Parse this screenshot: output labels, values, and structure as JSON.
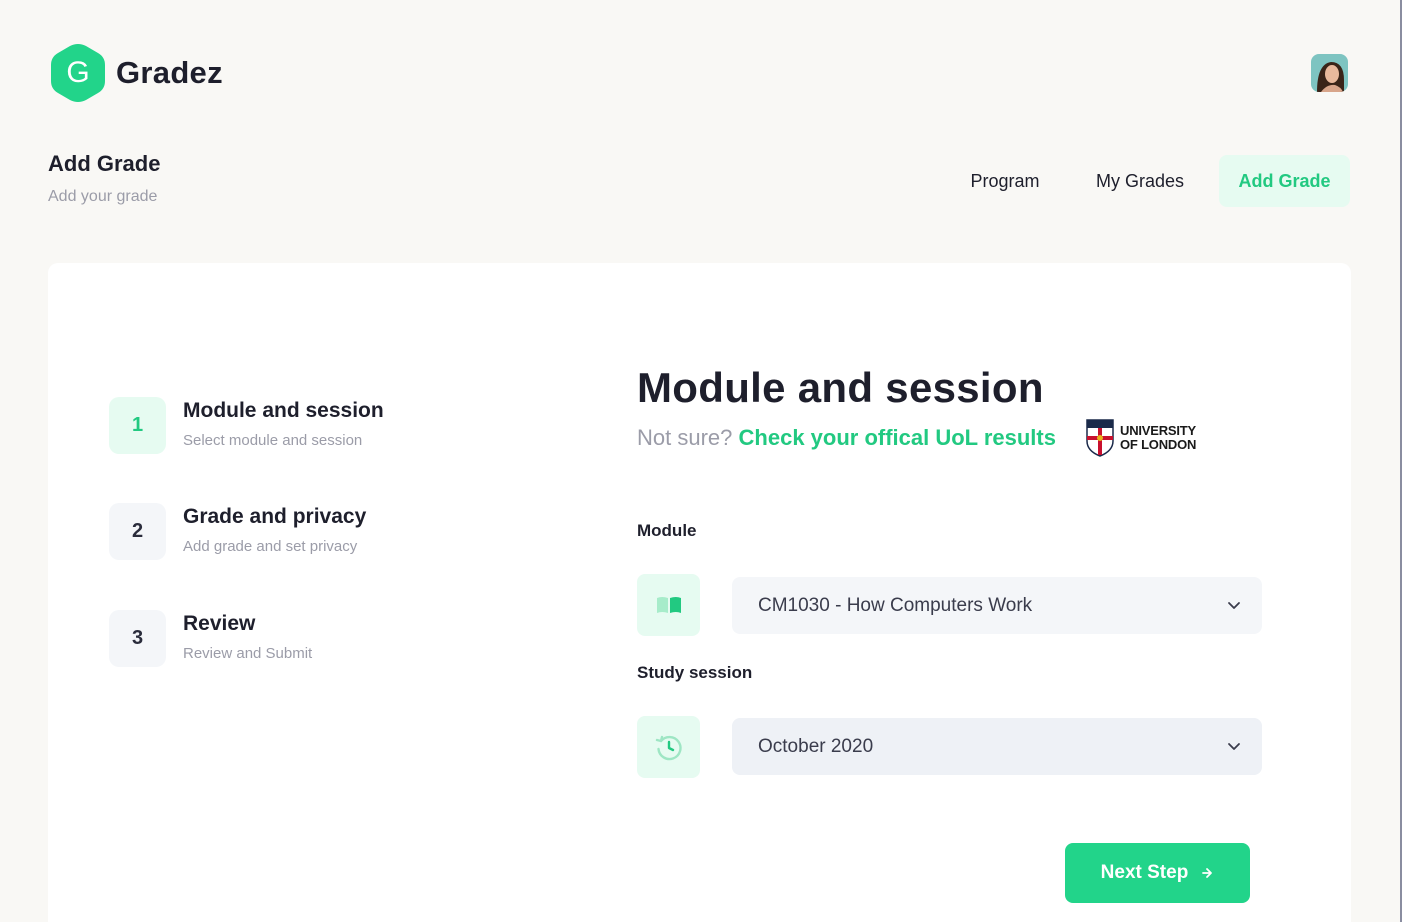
{
  "brand": {
    "letter": "G",
    "name": "Gradez",
    "accent": "#22c981"
  },
  "header": {
    "title": "Add Grade",
    "subtitle": "Add your grade",
    "avatar_icon": "user-avatar"
  },
  "nav": {
    "items": [
      {
        "label": "Program",
        "active": false
      },
      {
        "label": "My Grades",
        "active": false
      },
      {
        "label": "Add Grade",
        "active": true
      }
    ]
  },
  "steps": [
    {
      "number": "1",
      "title": "Module and session",
      "subtitle": "Select module and session",
      "active": true
    },
    {
      "number": "2",
      "title": "Grade and privacy",
      "subtitle": "Add grade and set privacy",
      "active": false
    },
    {
      "number": "3",
      "title": "Review",
      "subtitle": "Review and Submit",
      "active": false
    }
  ],
  "main": {
    "title": "Module and session",
    "not_sure": "Not sure?",
    "uol_link": "Check your offical UoL results",
    "uol_logo_line1": "UNIVERSITY",
    "uol_logo_line2": "OF LONDON"
  },
  "form": {
    "module_label": "Module",
    "module_value": "CM1030 - How Computers Work",
    "module_icon": "book-icon",
    "session_label": "Study session",
    "session_value": "October 2020",
    "session_icon": "history-clock-icon"
  },
  "actions": {
    "next_label": "Next Step"
  }
}
